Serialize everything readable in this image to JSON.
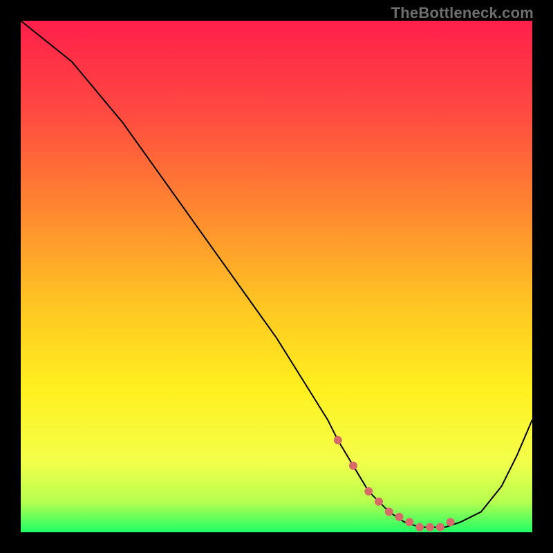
{
  "watermark": "TheBottleneck.com",
  "chart_data": {
    "type": "line",
    "title": "",
    "xlabel": "",
    "ylabel": "",
    "xlim": [
      0,
      100
    ],
    "ylim": [
      0,
      100
    ],
    "grid": false,
    "legend": false,
    "series": [
      {
        "name": "bottleneck-curve",
        "x": [
          0,
          5,
          10,
          15,
          20,
          25,
          30,
          35,
          40,
          45,
          50,
          55,
          60,
          62,
          65,
          68,
          70,
          72,
          75,
          78,
          80,
          83,
          86,
          90,
          94,
          97,
          100
        ],
        "values": [
          100,
          96,
          92,
          86,
          80,
          73,
          66,
          59,
          52,
          45,
          38,
          30,
          22,
          18,
          13,
          8,
          6,
          4,
          2,
          1,
          1,
          1,
          2,
          4,
          9,
          15,
          22
        ]
      }
    ],
    "markers": {
      "name": "sweet-spot-dots",
      "x": [
        62,
        65,
        68,
        70,
        72,
        74,
        76,
        78,
        80,
        82,
        84
      ],
      "values": [
        18,
        13,
        8,
        6,
        4,
        3,
        2,
        1,
        1,
        1,
        2
      ],
      "color": "#d86a6a",
      "radius": 6
    },
    "background_gradient": {
      "stops": [
        {
          "offset": 0.0,
          "color": "#ff1f4a"
        },
        {
          "offset": 0.18,
          "color": "#ff4a41"
        },
        {
          "offset": 0.38,
          "color": "#ff8b2f"
        },
        {
          "offset": 0.55,
          "color": "#ffc423"
        },
        {
          "offset": 0.72,
          "color": "#fff01f"
        },
        {
          "offset": 0.86,
          "color": "#f4ff4a"
        },
        {
          "offset": 0.94,
          "color": "#b8ff4f"
        },
        {
          "offset": 1.0,
          "color": "#1fff66"
        }
      ]
    },
    "curve_color": "#000000",
    "curve_width": 2
  }
}
